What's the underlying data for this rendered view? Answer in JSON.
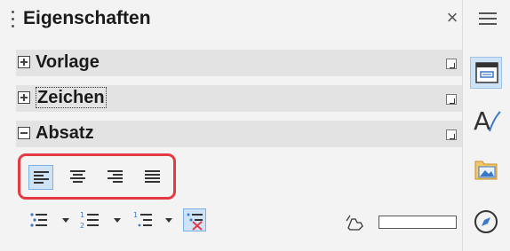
{
  "panel": {
    "title": "Eigenschaften",
    "close_glyph": "×",
    "sections": [
      {
        "label": "Vorlage",
        "state": "collapsed"
      },
      {
        "label": "Zeichen",
        "state": "collapsed"
      },
      {
        "label": "Absatz",
        "state": "expanded"
      }
    ]
  },
  "alignment": {
    "buttons": [
      {
        "icon": "align-left-icon",
        "active": true
      },
      {
        "icon": "align-center-icon",
        "active": false
      },
      {
        "icon": "align-right-icon",
        "active": false
      },
      {
        "icon": "align-justify-icon",
        "active": false
      }
    ]
  },
  "lists": {
    "buttons": [
      {
        "icon": "unordered-list-icon"
      },
      {
        "icon": "ordered-list-icon"
      },
      {
        "icon": "outline-list-icon"
      },
      {
        "icon": "no-list-icon",
        "active": true
      }
    ],
    "highlight_color": "#ffffff"
  },
  "deck": [
    {
      "icon": "properties-icon",
      "active": true
    },
    {
      "icon": "styles-icon"
    },
    {
      "icon": "gallery-icon"
    },
    {
      "icon": "navigator-icon"
    }
  ],
  "colors": {
    "accent_red": "#e63a43",
    "active_bg": "#cfe3f7",
    "section_bg": "#e3e3e3"
  }
}
